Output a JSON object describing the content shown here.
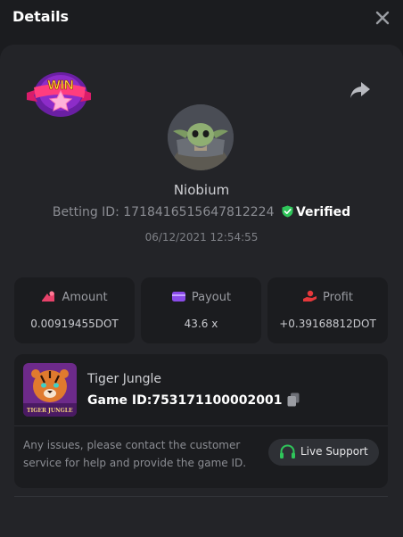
{
  "header": {
    "title": "Details",
    "close_icon": "close-icon"
  },
  "win_badge": {
    "text": "WIN"
  },
  "user": {
    "name": "Niobium",
    "betting_id_label": "Betting ID:",
    "betting_id": "1718416515647812224",
    "verified_label": "Verified",
    "datetime": "06/12/2021 12:54:55"
  },
  "stats": [
    {
      "label": "Amount",
      "value": "0.00919455DOT",
      "icon": "bet-icon",
      "icon_color": "#e8426a"
    },
    {
      "label": "Payout",
      "value": "43.6 x",
      "icon": "wallet-icon",
      "icon_color": "#8a4be8"
    },
    {
      "label": "Profit",
      "value": "+0.39168812DOT",
      "icon": "hand-coin-icon",
      "icon_color": "#e5383b"
    }
  ],
  "game": {
    "name": "Tiger Jungle",
    "id_label": "Game ID:",
    "id": "753171100002001",
    "thumb_title": "TIGER JUNGLE"
  },
  "support": {
    "text": "Any issues, please contact the customer service for help and provide the game ID.",
    "button_label": "Live Support"
  },
  "colors": {
    "verified_shield": "#2fc55a",
    "support_icon": "#2fc55a",
    "background": "#1b1c1f",
    "panel": "#232428"
  }
}
